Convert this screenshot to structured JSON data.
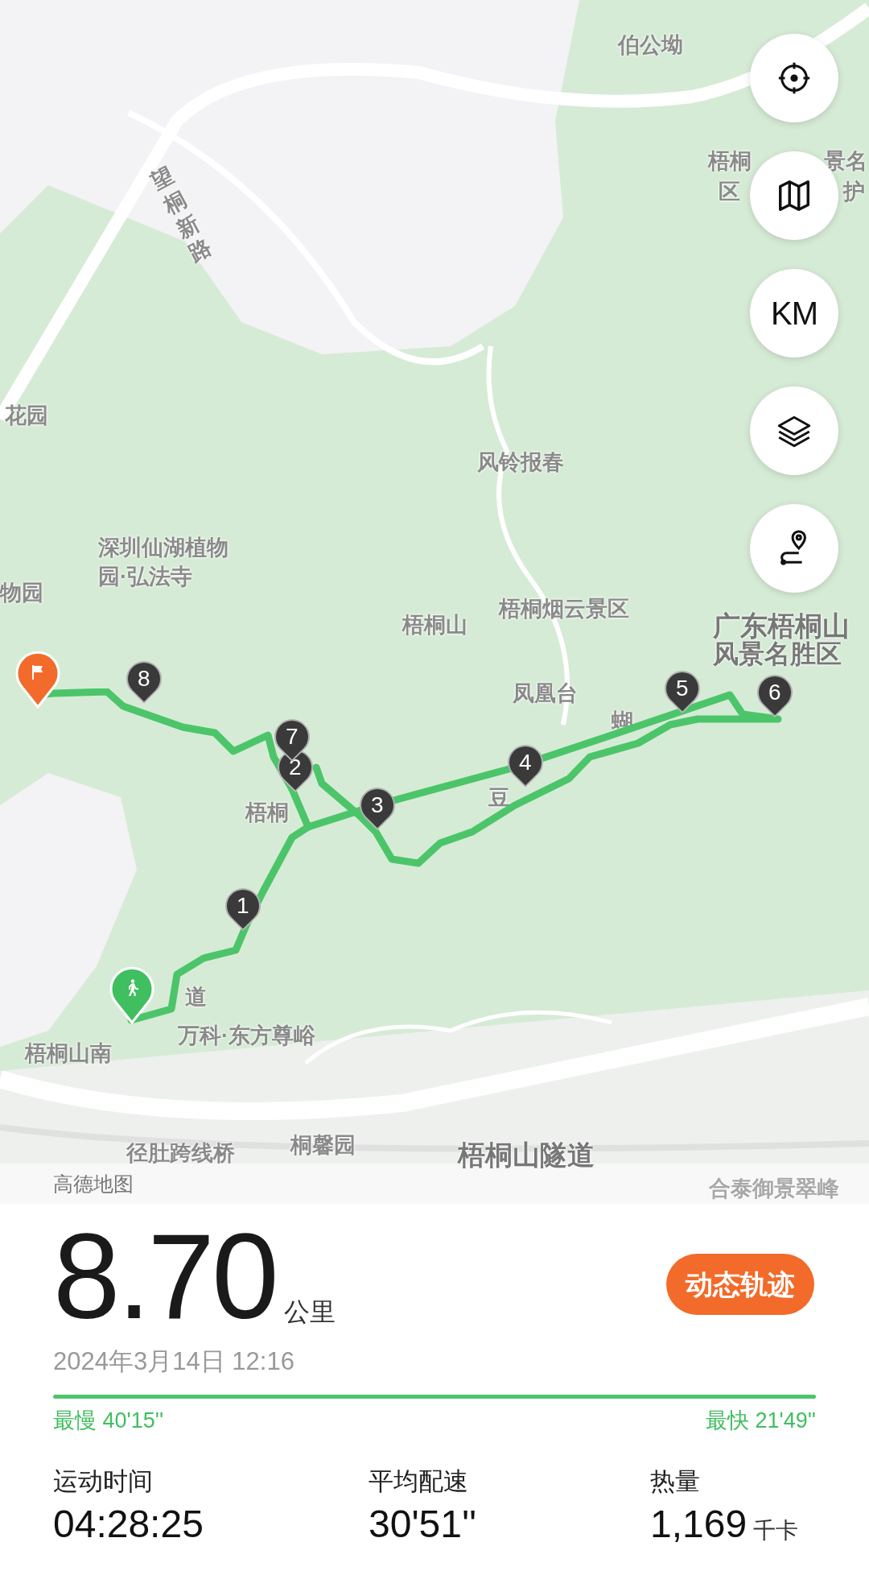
{
  "map": {
    "labels": [
      {
        "text": "伯公坳"
      },
      {
        "text": "梧桐"
      },
      {
        "text": "景名"
      },
      {
        "text": "区"
      },
      {
        "text": "护"
      },
      {
        "text": "望桐新路"
      },
      {
        "text": "花园"
      },
      {
        "text": "深圳仙湖植物"
      },
      {
        "text": "园·弘法寺"
      },
      {
        "text": "物园"
      },
      {
        "text": "风铃报春"
      },
      {
        "text": "梧桐山"
      },
      {
        "text": "梧桐烟云景区"
      },
      {
        "text": "广东梧桐山"
      },
      {
        "text": "风景名胜区"
      },
      {
        "text": "凤凰台"
      },
      {
        "text": "蝴"
      },
      {
        "text": "豆"
      },
      {
        "text": "梧桐"
      },
      {
        "text": "道"
      },
      {
        "text": "万科·东方尊峪"
      },
      {
        "text": "梧桐山南"
      },
      {
        "text": "径肚跨线桥"
      },
      {
        "text": "桐馨园"
      },
      {
        "text": "梧桐山隧道"
      },
      {
        "text": "合泰御景翠峰"
      }
    ],
    "route_markers": [
      {
        "label": "1"
      },
      {
        "label": "2"
      },
      {
        "label": "3"
      },
      {
        "label": "4"
      },
      {
        "label": "5"
      },
      {
        "label": "6"
      },
      {
        "label": "7"
      },
      {
        "label": "8"
      }
    ],
    "controls": [
      {
        "kind": "locate"
      },
      {
        "kind": "map"
      },
      {
        "kind": "text",
        "label": "KM"
      },
      {
        "kind": "layers"
      },
      {
        "kind": "route"
      }
    ],
    "attribution": "高德地图"
  },
  "summary": {
    "distance": "8.70",
    "unit": "公里",
    "replay_button": "动态轨迹",
    "date": "2024年3月14日 12:16",
    "slowest": "最慢 40'15''",
    "fastest": "最快 21'49''"
  },
  "stats": [
    {
      "label": "运动时间",
      "value": "04:28:25"
    },
    {
      "label": "平均配速",
      "value": "30'51''"
    },
    {
      "label": "热量",
      "value": "1,169",
      "unit": "千卡"
    }
  ]
}
